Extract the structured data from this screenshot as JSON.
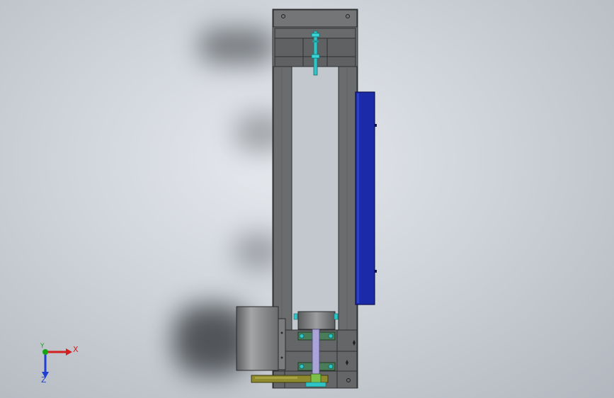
{
  "viewport": {
    "background_top": "#e6e9ee",
    "background_bottom": "#b1b7be"
  },
  "model": {
    "frame_color": "#6d6f71",
    "plate_color": "#5a5c5e",
    "panel_color": "#1a2aa8",
    "rod_color": "#2fc4c6",
    "arm_color": "#8f8a2e",
    "roller_color": "#7e8082",
    "bearing_color": "#4a7c57"
  },
  "triad": {
    "x_label": "X",
    "y_label": "Y",
    "z_label": "Z",
    "x_color": "#d21f1f",
    "y_color": "#16a316",
    "z_color": "#1f3ed2"
  }
}
